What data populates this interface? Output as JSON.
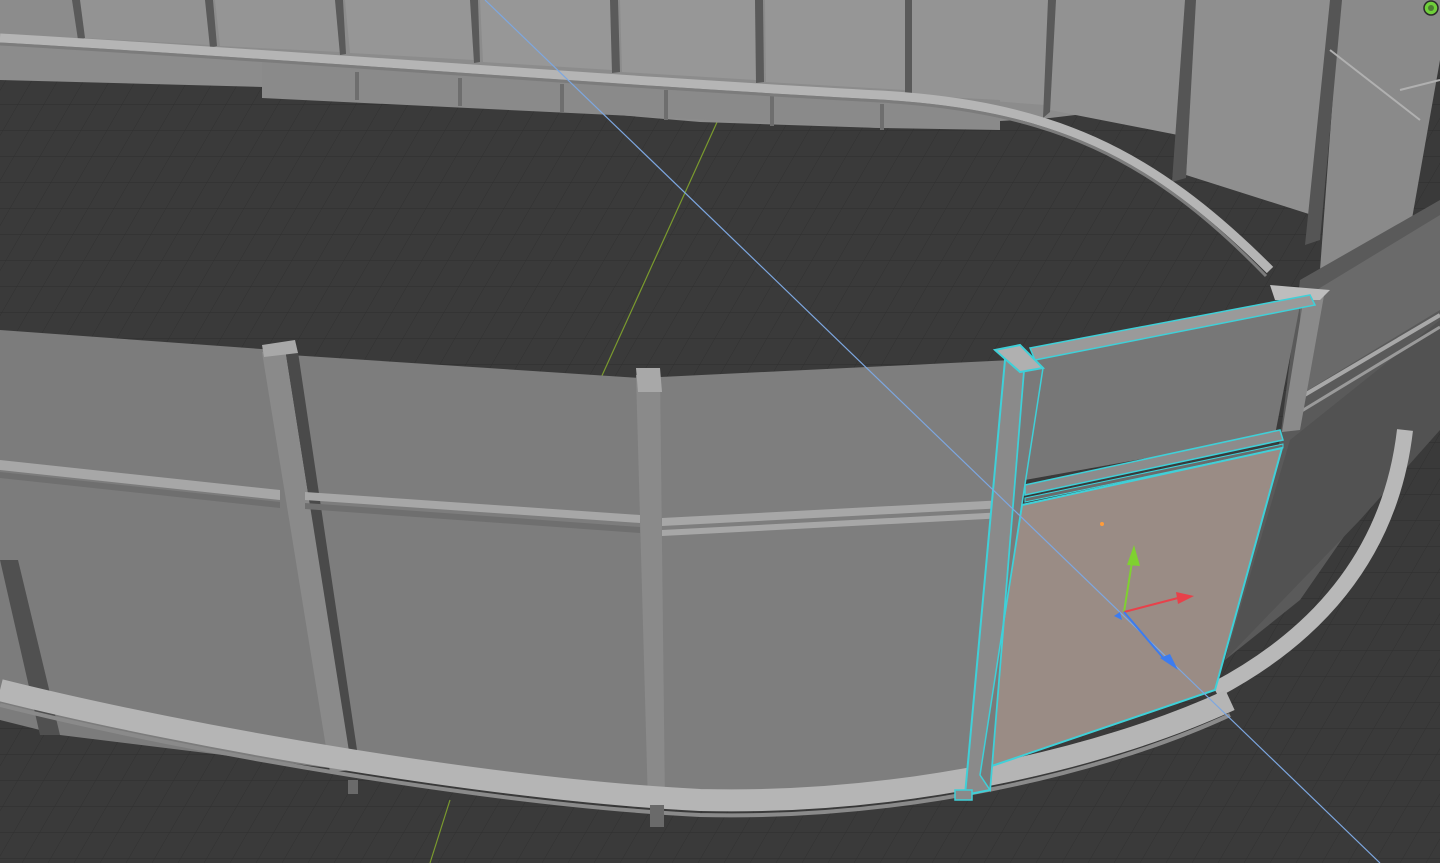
{
  "viewport": {
    "mode": "3d-edit-mode",
    "selection": "face",
    "background_color": "#3a3a3a",
    "grid_color": "#2f2f2f",
    "axis_y_color": "#7a9a2e",
    "axis_x_color": "#7da7e0",
    "selection_outline_color": "#3fd0d8",
    "selected_face_color": "#9a8c85"
  },
  "gizmo": {
    "y_axis_color": "#7fd130",
    "x_axis_color": "#e8414a",
    "z_axis_color": "#3c7cf0",
    "origin_color": "#ff9c3a"
  },
  "corner_widget": {
    "icon": "navigation-orb-icon",
    "color": "#6fcf3a"
  }
}
